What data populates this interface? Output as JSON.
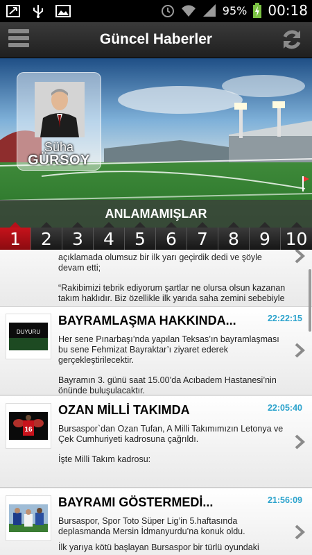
{
  "status_bar": {
    "icons": [
      "notification-icon",
      "usb-icon",
      "gallery-icon",
      "alarm-icon",
      "wifi-icon",
      "signal-icon",
      "battery-charging-icon"
    ],
    "battery": "95%",
    "time": "00:18"
  },
  "header": {
    "title": "Güncel Haberler",
    "menu_icon": "menu-icon",
    "refresh_icon": "refresh-icon"
  },
  "hero": {
    "name_first": "Süha",
    "name_last": "GÜRSOY",
    "caption": "ANLAMAMIŞLAR"
  },
  "pager": {
    "pages": [
      "1",
      "2",
      "3",
      "4",
      "5",
      "6",
      "7",
      "8",
      "9",
      "10"
    ],
    "active_color": "#c6121b"
  },
  "feed": {
    "partial_item": {
      "lines": [
        "açıklamada olumsuz bir ilk yarı geçirdik  dedi ve şöyle devam etti;",
        "“Rakibimizi tebrik ediyorum şartlar ne olursa olsun kazanan takım haklıdır. Biz özellikle ilk yarıda saha zemini sebebiyle"
      ]
    },
    "items": [
      {
        "headline": "BAYRAMLAŞMA HAKKINDA...",
        "time": "22:22:15",
        "thumb_label": "DUYURU",
        "paragraphs": [
          "Her sene Pınarbaşı’nda yapılan Teksas’ın bayramlaşması bu sene Fehmizat Bayraktar’ı ziyaret ederek gerçekleştirilecektir.",
          "Bayramın 3. günü saat 15.00’da Acıbadem Hastanesi’nin önünde buluşulacaktır."
        ]
      },
      {
        "headline": "OZAN MİLLİ TAKIMDA",
        "time": "22:05:40",
        "thumb_label": "",
        "paragraphs": [
          "Bursaspor`dan Ozan Tufan, A Milli Takımımızın Letonya ve Çek Cumhuriyeti kadrosuna çağrıldı.",
          "İşte Milli Takım kadrosu:"
        ]
      },
      {
        "headline": "BAYRAMI GÖSTERMEDİ...",
        "time": "21:56:09",
        "thumb_label": "",
        "paragraphs": [
          "Bursaspor, Spor Toto Süper Lig’in 5.haftasında deplasmanda Mersin İdmanyurdu’na konuk oldu.",
          "İlk yarıya kötü başlayan Bursaspor bir türlü oyundaki"
        ]
      }
    ],
    "time_color": "#2aa2cc"
  }
}
